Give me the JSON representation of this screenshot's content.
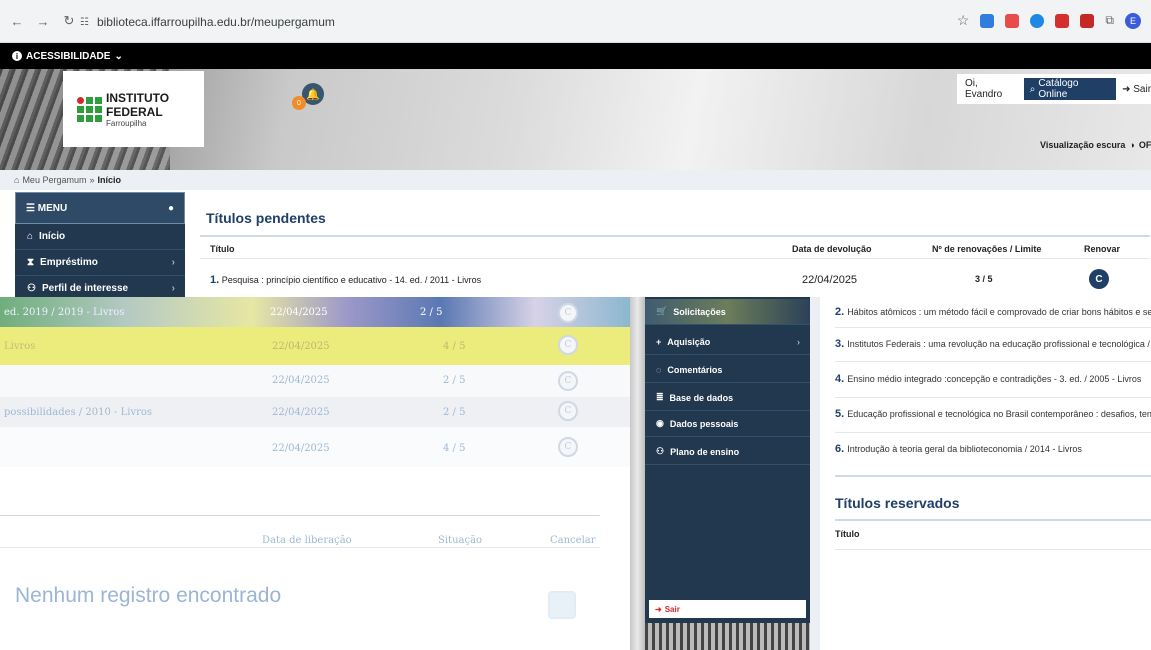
{
  "browser": {
    "url": "biblioteca.iffarroupilha.edu.br/meupergamum",
    "profile_initial": "E"
  },
  "accessibility": {
    "label": "ACESSIBILIDADE"
  },
  "header": {
    "logo_name": "INSTITUTO FEDERAL",
    "logo_sub": "Farroupilha",
    "notification_count": "0",
    "greeting": "Oi, Evandro",
    "catalog_button": "Catálogo Online",
    "logout_button": "Sair",
    "dark_mode_label": "Visualização escura",
    "dark_mode_state": "OFF"
  },
  "breadcrumb": {
    "root": "Meu Pergamum",
    "current": "Início"
  },
  "sidebar": {
    "menu_label": "MENU",
    "items": [
      {
        "label": "Início"
      },
      {
        "label": "Empréstimo"
      },
      {
        "label": "Perfil de interesse"
      },
      {
        "label": "Solicitações"
      },
      {
        "label": "Aquisição"
      },
      {
        "label": "Comentários"
      },
      {
        "label": "Base de dados"
      },
      {
        "label": "Dados pessoais"
      },
      {
        "label": "Plano de ensino"
      }
    ],
    "logout": "Sair"
  },
  "pending": {
    "title": "Títulos pendentes",
    "columns": {
      "title": "Título",
      "due": "Data de devolução",
      "renewals": "Nº de renovações / Limite",
      "renew": "Renovar"
    },
    "rows": [
      {
        "num": "1.",
        "title": "Pesquisa : princípio científico e educativo - 14. ed. / 2011 - Livros",
        "due": "22/04/2025",
        "renewals": "3 / 5"
      }
    ]
  },
  "glitch": {
    "rows": [
      {
        "title": "ed. 2019 / 2019 - Livros",
        "due": "22/04/2025",
        "renewals": "2 / 5"
      },
      {
        "title": "Livros",
        "due": "22/04/2025",
        "renewals": "4 / 5"
      },
      {
        "title": "",
        "due": "22/04/2025",
        "renewals": "2 / 5"
      },
      {
        "title": "possibilidades / 2010 - Livros",
        "due": "22/04/2025",
        "renewals": "2 / 5"
      },
      {
        "title": "",
        "due": "22/04/2025",
        "renewals": "4 / 5"
      }
    ],
    "reserved_columns": {
      "release": "Data de liberação",
      "status": "Situação",
      "cancel": "Cancelar"
    },
    "empty_message": "Nenhum registro encontrado"
  },
  "right_list": [
    {
      "num": "2.",
      "title": "Hábitos atômicos : um método fácil e comprovado de criar bons hábitos e se livrar"
    },
    {
      "num": "3.",
      "title": "Institutos Federais : uma revolução na educação profissional e tecnológica / 2019"
    },
    {
      "num": "4.",
      "title": "Ensino médio integrado :concepção e contradições - 3. ed. / 2005 - Livros"
    },
    {
      "num": "5.",
      "title": "Educação profissional e tecnológica no Brasil contemporâneo : desafios, tensões"
    },
    {
      "num": "6.",
      "title": "Introdução à teoria geral da biblioteconomia / 2014 - Livros"
    }
  ],
  "reserved": {
    "title": "Títulos reservados",
    "column_title": "Título"
  }
}
